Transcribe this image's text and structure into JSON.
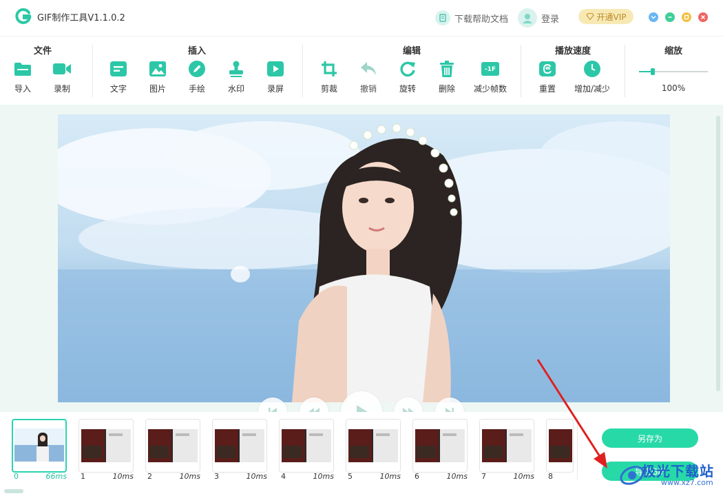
{
  "app": {
    "title": "GIF制作工具V1.1.0.2"
  },
  "header": {
    "help_label": "下载帮助文档",
    "login_label": "登录",
    "vip_label": "开通VIP"
  },
  "toolbar": {
    "groups": [
      {
        "title": "文件",
        "items": [
          {
            "label": "导入",
            "icon": "folder-icon"
          },
          {
            "label": "录制",
            "icon": "video-camera-icon"
          }
        ]
      },
      {
        "title": "插入",
        "items": [
          {
            "label": "文字",
            "icon": "text-icon"
          },
          {
            "label": "图片",
            "icon": "image-icon"
          },
          {
            "label": "手绘",
            "icon": "pencil-icon"
          },
          {
            "label": "水印",
            "icon": "stamp-icon"
          },
          {
            "label": "录屏",
            "icon": "screen-record-icon"
          }
        ]
      },
      {
        "title": "编辑",
        "items": [
          {
            "label": "剪裁",
            "icon": "crop-icon"
          },
          {
            "label": "撤销",
            "icon": "undo-icon"
          },
          {
            "label": "旋转",
            "icon": "rotate-icon"
          },
          {
            "label": "删除",
            "icon": "trash-icon"
          },
          {
            "label": "减少帧数",
            "icon": "reduce-frames-icon",
            "badge": "-1F"
          }
        ]
      },
      {
        "title": "播放速度",
        "items": [
          {
            "label": "重置",
            "icon": "reset-icon"
          },
          {
            "label": "增加/减少",
            "icon": "clock-icon"
          }
        ]
      },
      {
        "title": "缩放"
      }
    ],
    "zoom": {
      "value_label": "100%",
      "level": 0.2
    }
  },
  "frames": [
    {
      "index": "0",
      "delay": "66ms"
    },
    {
      "index": "1",
      "delay": "10ms"
    },
    {
      "index": "2",
      "delay": "10ms"
    },
    {
      "index": "3",
      "delay": "10ms"
    },
    {
      "index": "4",
      "delay": "10ms"
    },
    {
      "index": "5",
      "delay": "10ms"
    },
    {
      "index": "6",
      "delay": "10ms"
    },
    {
      "index": "7",
      "delay": "10ms"
    },
    {
      "index": "8",
      "delay": ""
    }
  ],
  "actions": {
    "save_as_label": "另存为",
    "export_label": "导出GIF"
  },
  "watermark": {
    "text": "极光下载站",
    "sub": "www.xz7.com"
  },
  "colors": {
    "accent": "#28d9a8",
    "selected_frame": "#2bd3b1",
    "arrow": "#e02020"
  }
}
